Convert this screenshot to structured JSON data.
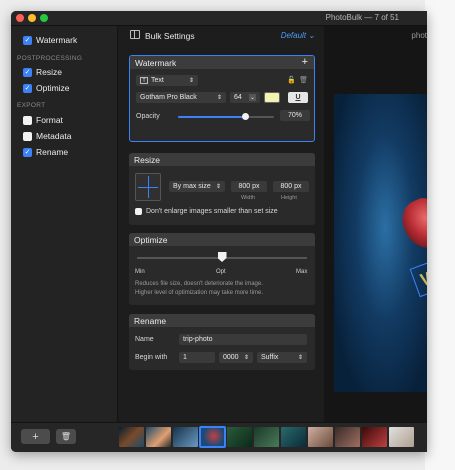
{
  "window": {
    "title": "PhotoBulk — 7 of 51"
  },
  "sidebar": {
    "items": [
      {
        "label": "Watermark",
        "checked": true
      },
      {
        "section": "POSTPROCESSING"
      },
      {
        "label": "Resize",
        "checked": true
      },
      {
        "label": "Optimize",
        "checked": true
      },
      {
        "section": "EXPORT"
      },
      {
        "label": "Format",
        "checked": false
      },
      {
        "label": "Metadata",
        "checked": false
      },
      {
        "label": "Rename",
        "checked": true
      }
    ],
    "add_label": "+",
    "trash_label": "🗑"
  },
  "settings": {
    "title": "Bulk Settings",
    "preset": "Default",
    "watermark": {
      "title": "Watermark",
      "add": "+",
      "type": "Text",
      "font": "Gotham Pro Black",
      "size": "64",
      "opacity_label": "Opacity",
      "opacity_value": "70%",
      "opacity_fraction": 0.7,
      "color": "#f5f3b0"
    },
    "resize": {
      "title": "Resize",
      "mode": "By max size",
      "width": "800 px",
      "width_label": "Width",
      "height": "800 px",
      "height_label": "Height",
      "no_enlarge": "Don't enlarge images smaller than set size"
    },
    "optimize": {
      "title": "Optimize",
      "min": "Min",
      "opt": "Opt",
      "max": "Max",
      "level_fraction": 0.5,
      "note1": "Reduces file size, doesn't deteriorate the image.",
      "note2": "Higher level of optimization may take more time."
    },
    "rename": {
      "title": "Rename",
      "name_label": "Name",
      "name_value": "trip-photo",
      "begin_label": "Begin with",
      "begin_value": "1",
      "digits": "0000",
      "position": "Suffix"
    }
  },
  "preview": {
    "tab_label": "phot",
    "watermark_letter": "W"
  },
  "colors": {
    "accent": "#3b82f6"
  }
}
